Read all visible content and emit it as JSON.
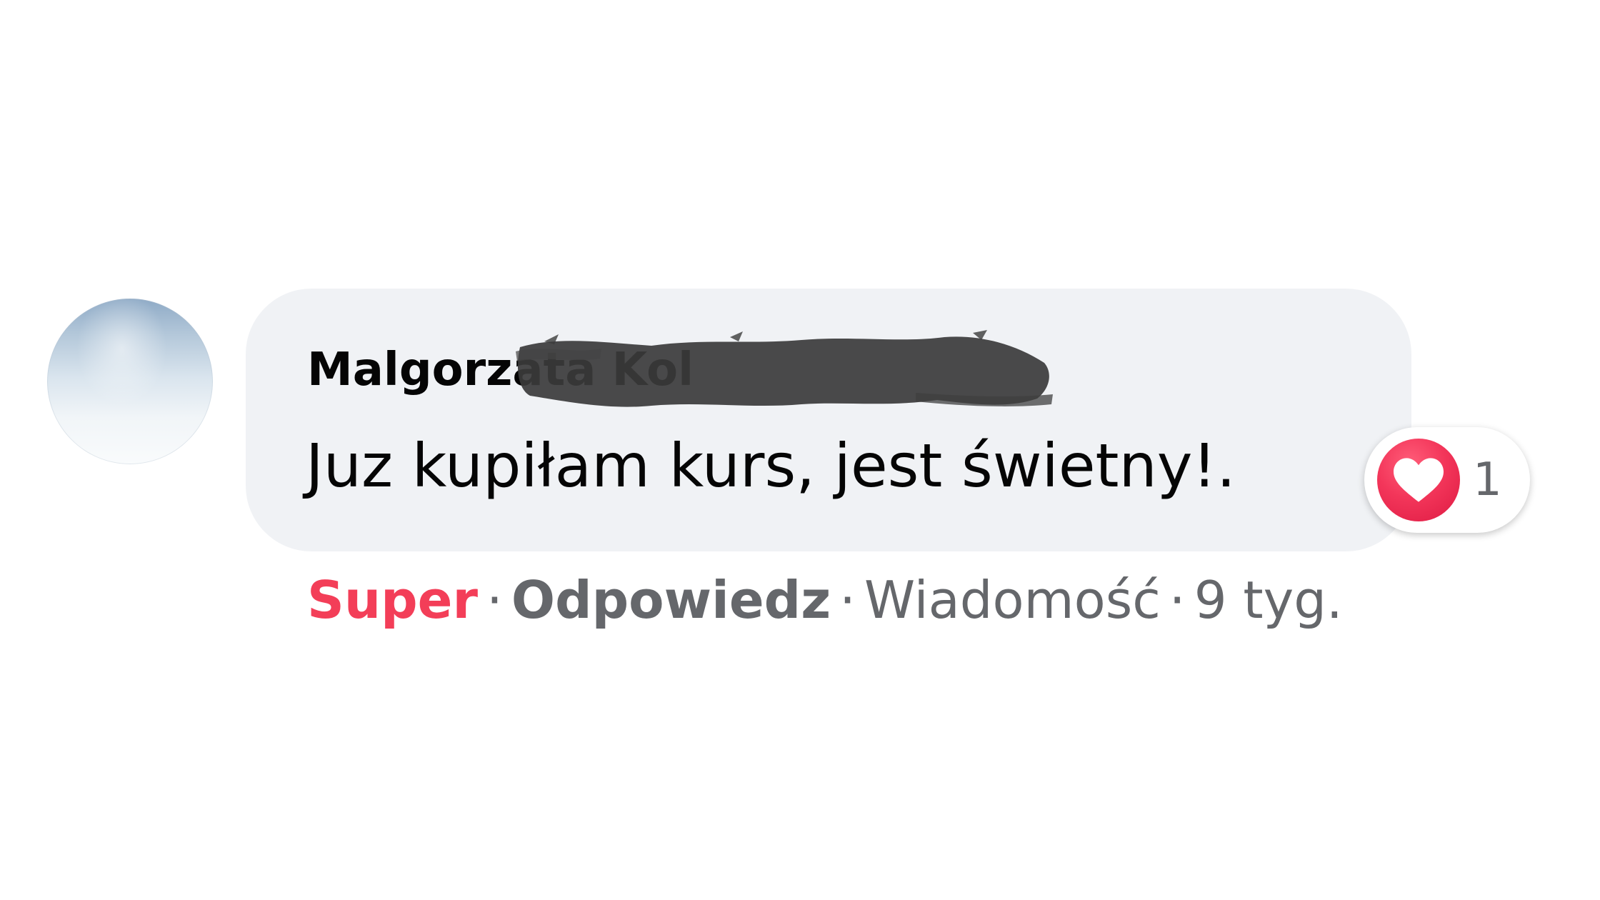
{
  "comment": {
    "author_name": "Malgorzata Kol",
    "text": "Juz kupiłam kurs, jest świetny!.",
    "reaction": {
      "icon": "heart-icon",
      "count": "1",
      "color": "#f33e58"
    }
  },
  "actions": {
    "like_label": "Super",
    "reply_label": "Odpowiedz",
    "message_label": "Wiadomość",
    "separator": "·",
    "timestamp": "9 tyg."
  },
  "colors": {
    "bubble_bg": "#f0f2f5",
    "text": "#050505",
    "secondary_text": "#65676b",
    "like_active": "#f33e58"
  }
}
